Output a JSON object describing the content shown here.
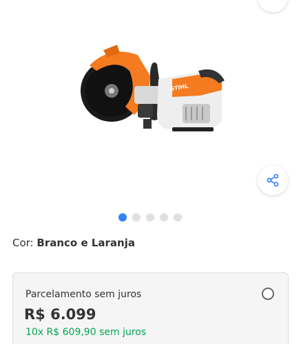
{
  "product": {
    "image_alt": "Cortadora a gasolina laranja e branca",
    "brand_mark": "STIHL"
  },
  "gallery": {
    "dot_count": 5,
    "active_index": 0
  },
  "color": {
    "label": "Cor:",
    "value": "Branco e Laranja"
  },
  "payment": {
    "title": "Parcelamento sem juros",
    "price": "R$ 6.099",
    "installments": "10x R$ 609,90 sem juros"
  },
  "icons": {
    "share": "share-icon"
  },
  "colors": {
    "accent": "#3483fa",
    "installments_green": "#00a650",
    "product_orange": "#f47b20"
  }
}
